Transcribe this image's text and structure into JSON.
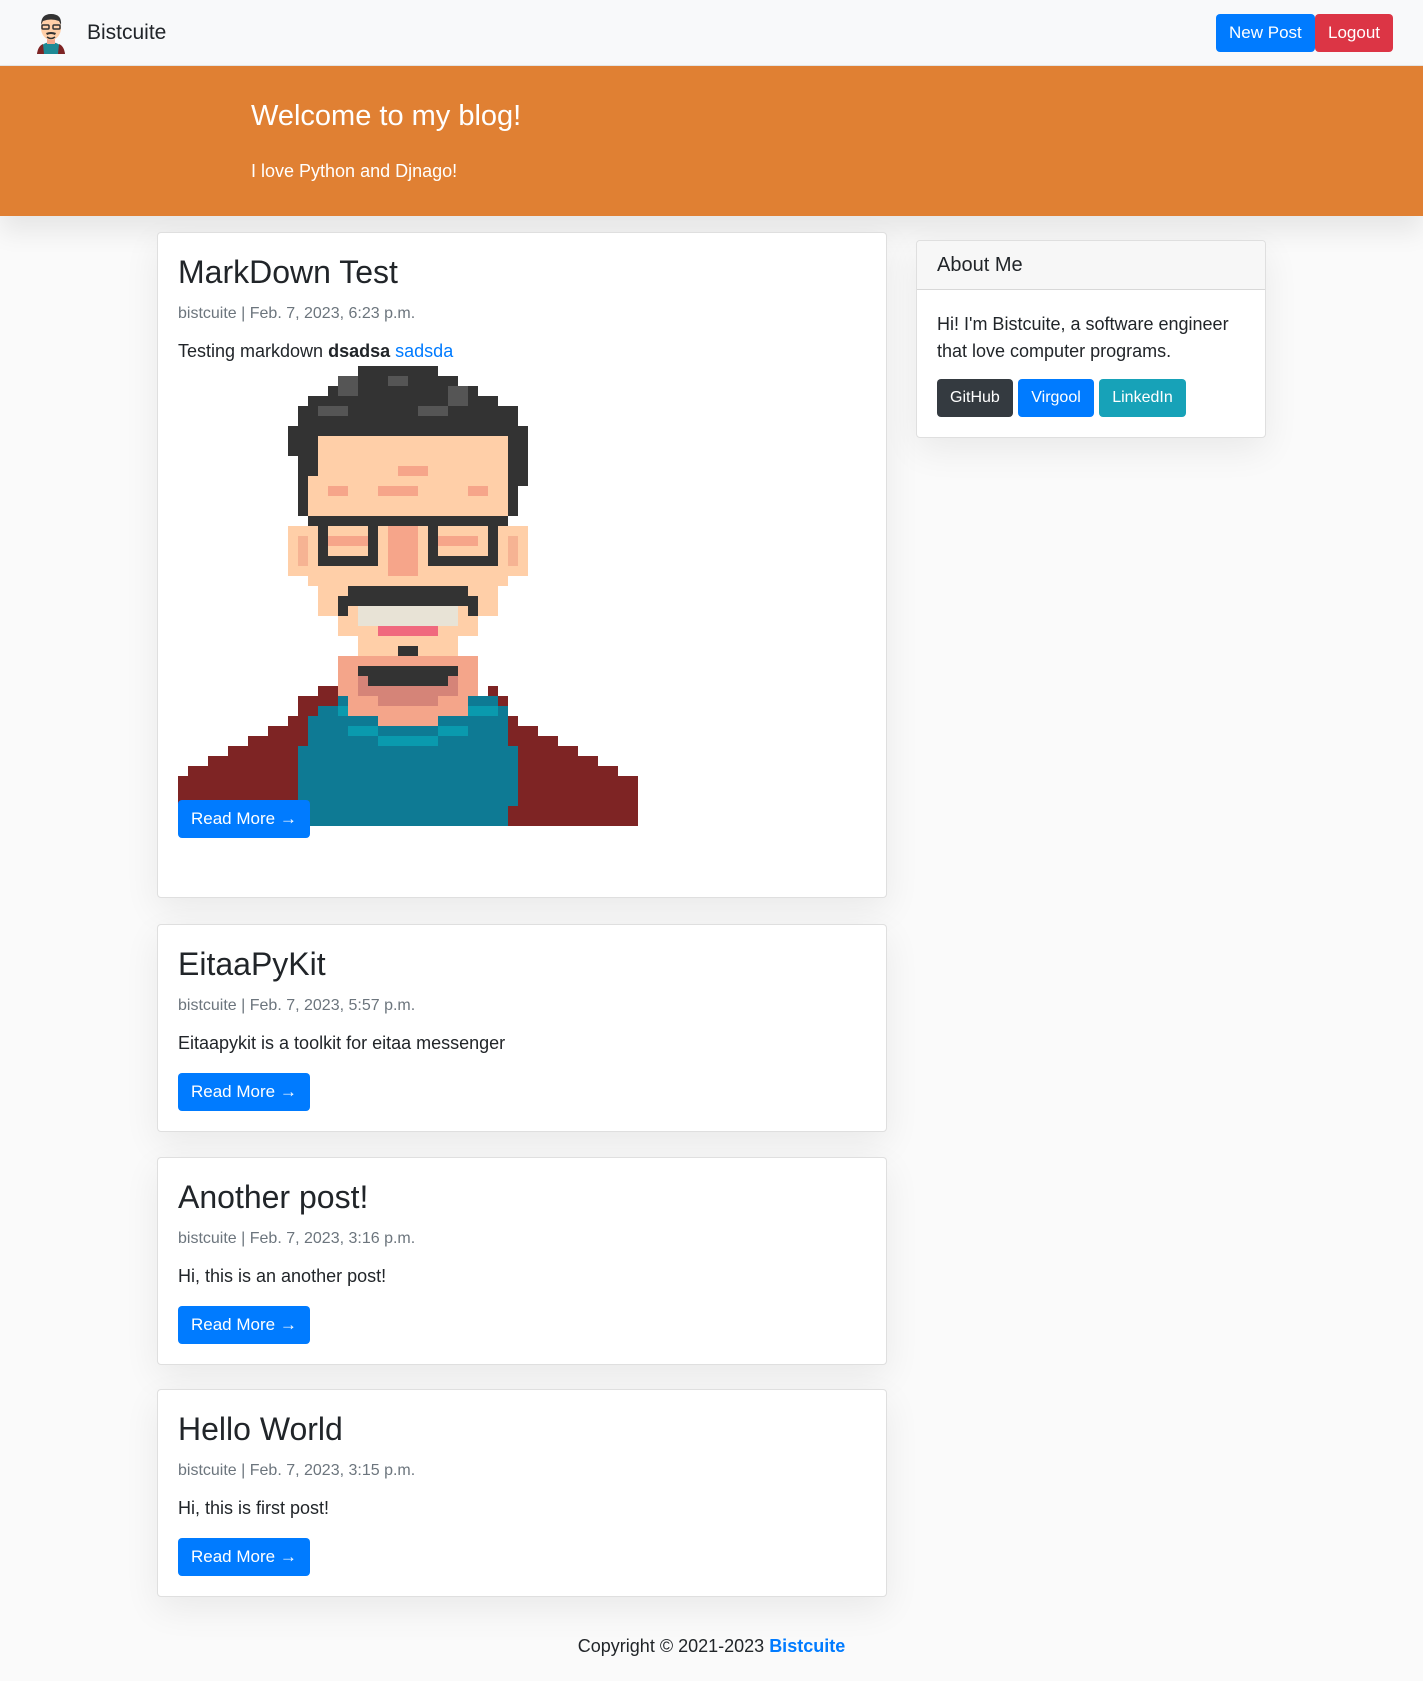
{
  "nav": {
    "brand": "Bistcuite",
    "new_post": "New Post",
    "logout": "Logout"
  },
  "header": {
    "title": "Welcome to my blog!",
    "subtitle": "I love Python and Djnago!"
  },
  "posts": [
    {
      "title": "MarkDown Test",
      "meta": "bistcuite | Feb. 7, 2023, 6:23 p.m.",
      "text": "Testing markdown",
      "bold": "dsadsa",
      "link": "sadsda",
      "read_more": "Read More →"
    },
    {
      "title": "EitaaPyKit",
      "meta": "bistcuite | Feb. 7, 2023, 5:57 p.m.",
      "text": "Eitaapykit is a toolkit for eitaa messenger",
      "read_more": "Read More →"
    },
    {
      "title": "Another post!",
      "meta": "bistcuite | Feb. 7, 2023, 3:16 p.m.",
      "text": "Hi, this is an another post!",
      "read_more": "Read More →"
    },
    {
      "title": "Hello World",
      "meta": "bistcuite | Feb. 7, 2023, 3:15 p.m.",
      "text": "Hi, this is first post!",
      "read_more": "Read More →"
    }
  ],
  "sidebar": {
    "title": "About Me",
    "text": "Hi! I'm Bistcuite, a software engineer that love computer programs.",
    "links": [
      "GitHub",
      "Virgool",
      "LinkedIn"
    ]
  },
  "footer": {
    "text": "Copyright © 2021-2023",
    "brand": "Bistcuite"
  },
  "colors": {
    "header_bg": "#e08033",
    "primary": "#007bff",
    "danger": "#dc3545",
    "dark": "#343a40",
    "info": "#17a2b8"
  }
}
